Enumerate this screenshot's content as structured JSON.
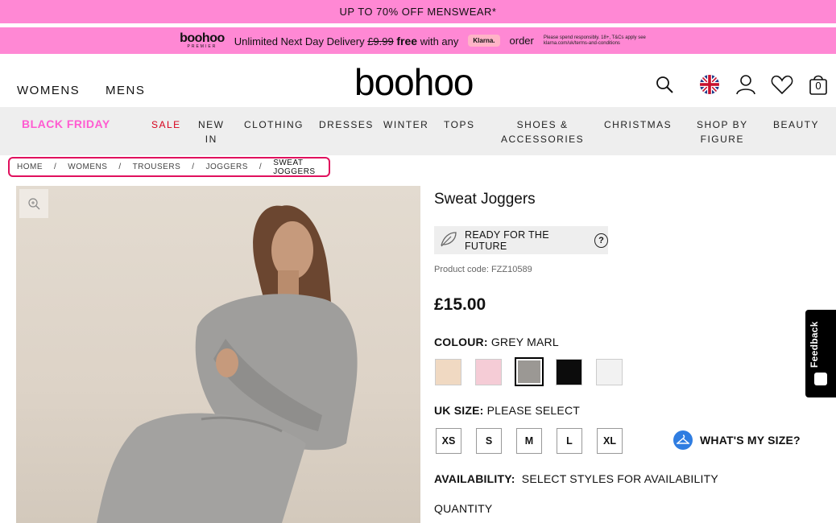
{
  "promo": {
    "top_banner": "UP TO 70% OFF MENSWEAR*",
    "premier_logo": "boohoo",
    "premier_sub": "PREMIER",
    "delivery_text": "Unlimited Next Day Delivery",
    "old_price": "£9.99",
    "free_text": "free",
    "with_any": "with any",
    "klarna_label": "Klarna.",
    "order_text": "order",
    "small_print": "Please spend responsibly. 18+, T&Cs apply see klarna.com/uk/terms-and-conditions"
  },
  "header": {
    "womens": "WOMENS",
    "mens": "MENS",
    "logo": "boohoo",
    "bag_count": "0",
    "icons": [
      "search-icon",
      "uk-flag-icon",
      "account-icon",
      "wishlist-heart-icon",
      "bag-icon"
    ]
  },
  "menu": {
    "black_friday": "BLACK FRIDAY",
    "sale": "SALE",
    "new_in_1": "NEW",
    "new_in_2": "IN",
    "clothing": "CLOTHING",
    "dresses": "DRESSES",
    "winter": "WINTER",
    "tops": "TOPS",
    "shoes_1": "SHOES &",
    "shoes_2": "ACCESSORIES",
    "christmas": "CHRISTMAS",
    "shop_fig_1": "SHOP BY",
    "shop_fig_2": "FIGURE",
    "beauty": "BEAUTY"
  },
  "breadcrumb": {
    "items": [
      "HOME",
      "WOMENS",
      "TROUSERS",
      "JOGGERS"
    ],
    "current": "SWEAT JOGGERS",
    "separator": "/"
  },
  "product": {
    "title": "Sweat Joggers",
    "future_label": "READY FOR THE FUTURE",
    "help_glyph": "?",
    "code_label": "Product code:",
    "code_value": "FZZ10589",
    "price": "£15.00",
    "colour_label": "COLOUR:",
    "colour_value": "GREY MARL",
    "colours": [
      {
        "name": "nude",
        "hex": "#f0d9c2"
      },
      {
        "name": "pink",
        "hex": "#f5ccd6"
      },
      {
        "name": "grey marl",
        "hex": "#9b9894",
        "selected": true
      },
      {
        "name": "black",
        "hex": "#0c0c0c"
      },
      {
        "name": "white",
        "hex": "#f2f2f2"
      }
    ],
    "size_label": "UK SIZE:",
    "size_value": "PLEASE SELECT",
    "sizes": [
      "XS",
      "S",
      "M",
      "L",
      "XL"
    ],
    "whats_my_size": "WHAT'S MY SIZE?",
    "availability_label": "AVAILABILITY:",
    "availability_value": "SELECT STYLES FOR AVAILABILITY",
    "quantity_label": "QUANTITY"
  },
  "feedback": {
    "label": "Feedback"
  }
}
